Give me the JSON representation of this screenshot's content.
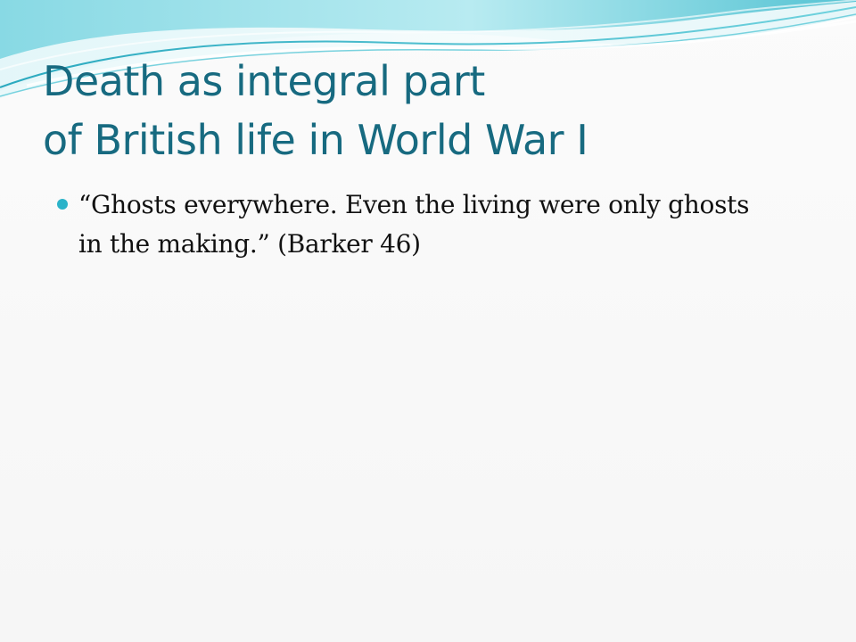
{
  "slide": {
    "title_line1": "Death as integral part",
    "title_line2": "of British life in World War I",
    "bullets": [
      {
        "line1": "“Ghosts everywhere.  Even the living were only ghosts",
        "line2": "in the making.”  (Barker 46)"
      }
    ]
  },
  "colors": {
    "title": "#176a80",
    "bullet": "#2bb3c9",
    "wave_light": "#c9eef2",
    "wave_mid": "#79d1dd",
    "wave_dark": "#2bb3c9"
  },
  "icons": {
    "bullet": "bullet-dot-icon"
  }
}
